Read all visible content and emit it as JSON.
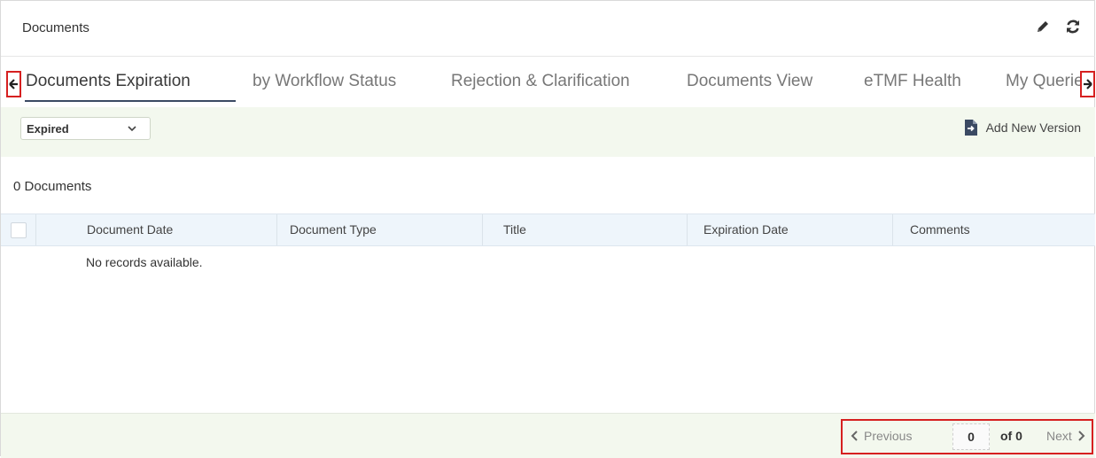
{
  "panel": {
    "title": "Documents"
  },
  "header_icons": [
    "pencil-icon",
    "refresh-icon"
  ],
  "tabs": [
    {
      "label": "Documents Expiration",
      "active": true
    },
    {
      "label": "by Workflow Status"
    },
    {
      "label": "Rejection & Clarification"
    },
    {
      "label": "Documents View"
    },
    {
      "label": "eTMF Health"
    },
    {
      "label": "My Queries"
    }
  ],
  "toolbar": {
    "filter_value": "Expired",
    "add_version_label": "Add New Version"
  },
  "count_text": "0 Documents",
  "table": {
    "columns": [
      "Document Date",
      "Document Type",
      "Title",
      "Expiration Date",
      "Comments"
    ],
    "empty_text": "No records available."
  },
  "pager": {
    "previous_label": "Previous",
    "page_value": "0",
    "of_text": "of 0",
    "next_label": "Next"
  },
  "colors": {
    "highlight": "#d62020",
    "toolbar_bg": "#f3f8ee",
    "header_row_bg": "#eef5fb",
    "active_underline": "#3b4a63"
  }
}
